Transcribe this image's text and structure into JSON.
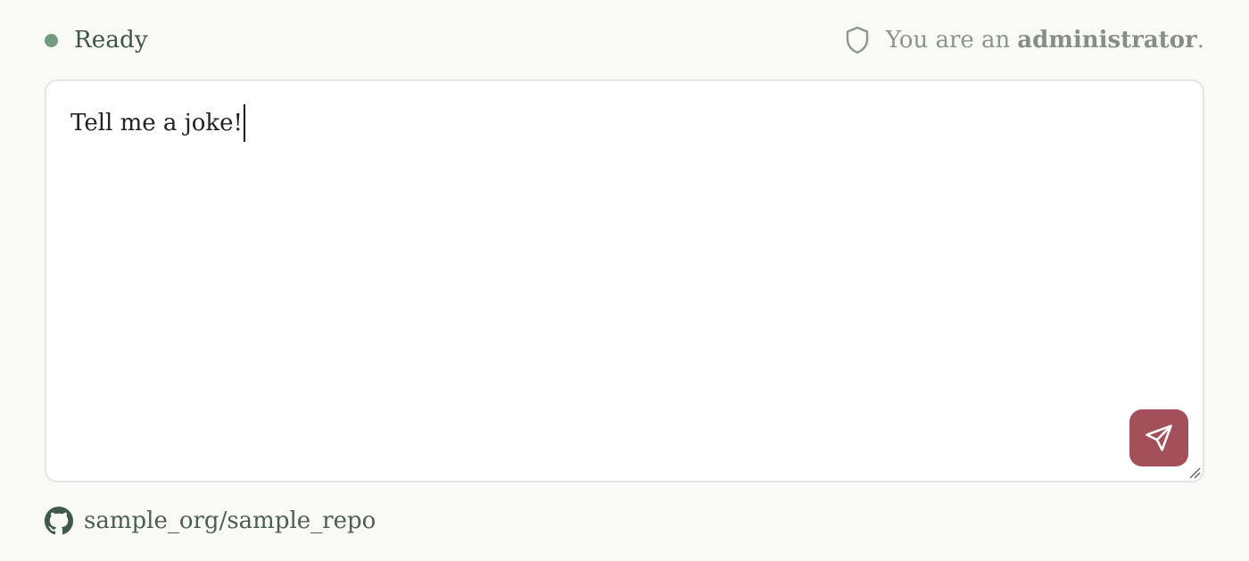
{
  "status": {
    "label": "Ready",
    "dot_color": "#749a80"
  },
  "role": {
    "prefix": "You are an",
    "name": "administrator",
    "suffix": ".",
    "icon": "shield-icon"
  },
  "editor": {
    "value": "Tell me a joke!"
  },
  "send_button": {
    "icon": "send-icon",
    "color": "#a3505b"
  },
  "footer": {
    "icon": "github-icon",
    "repo": "sample_org/sample_repo"
  }
}
